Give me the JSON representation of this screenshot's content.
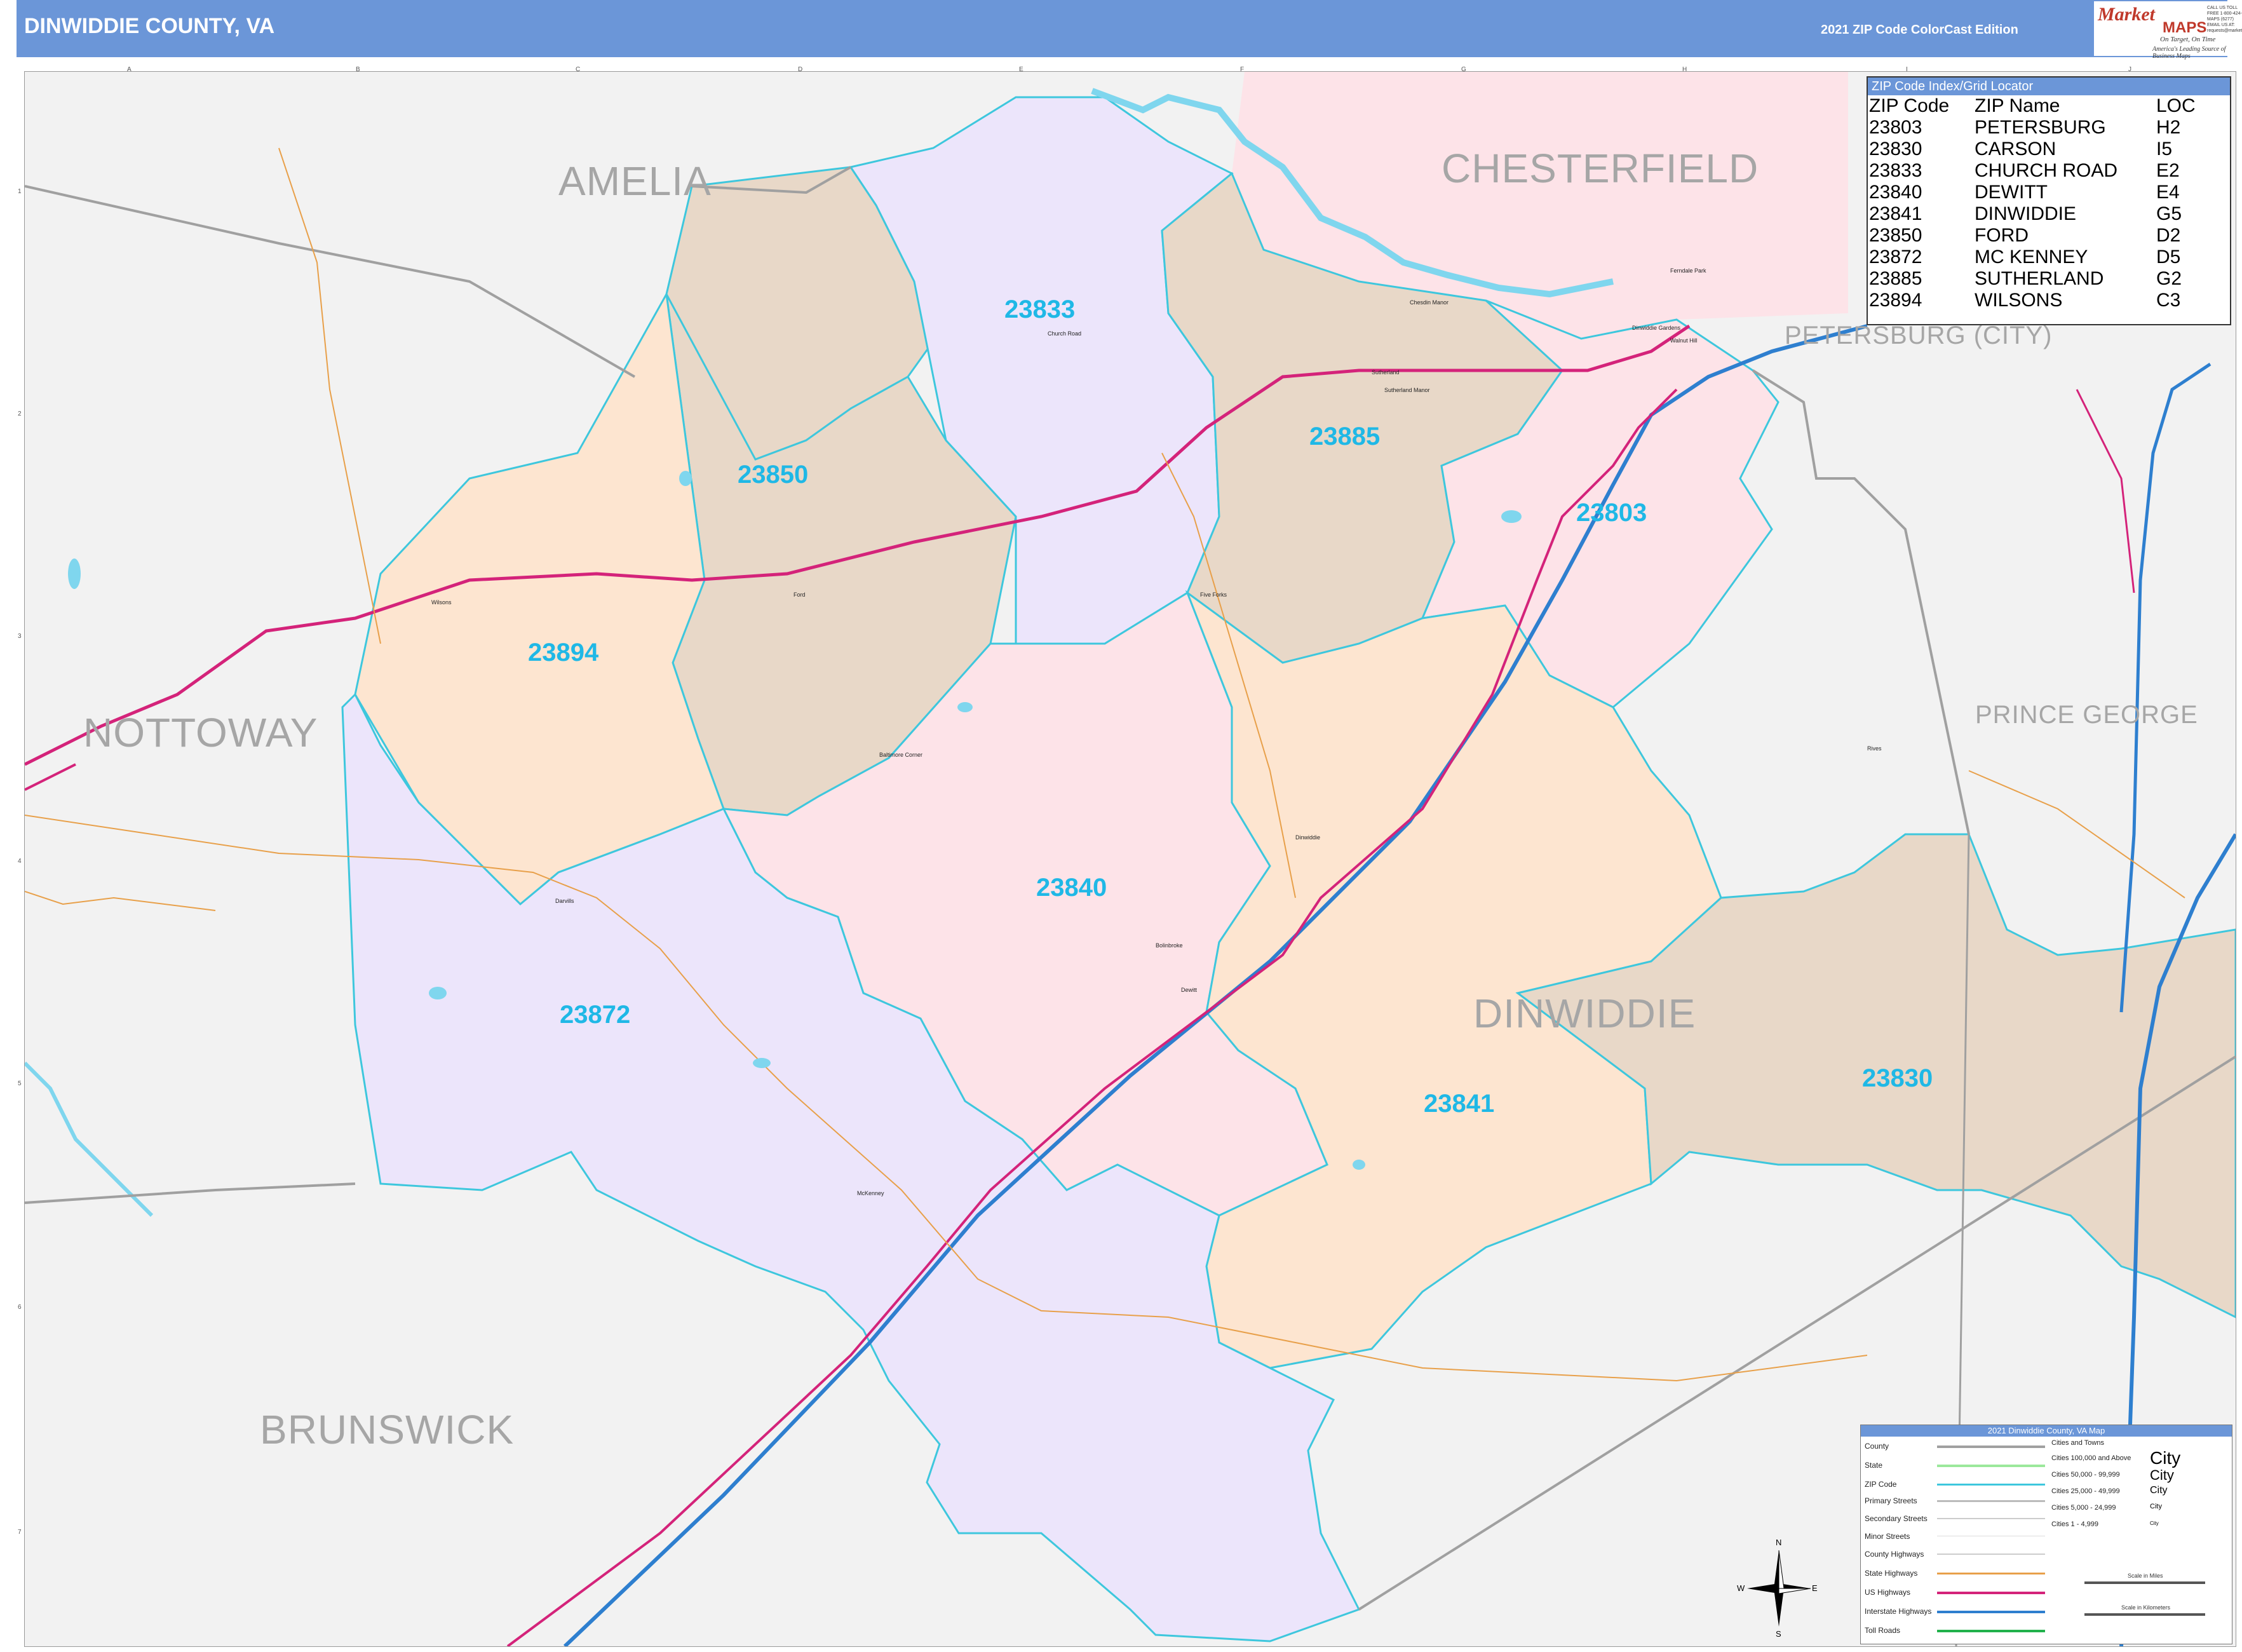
{
  "header": {
    "title": "DINWIDDIE COUNTY, VA",
    "edition": "2021 ZIP Code ColorCast Edition"
  },
  "logo": {
    "brand_top": "Market",
    "brand_bottom": "MAPS",
    "tagline1": "On Target, On Time",
    "tagline2": "America's Leading Source of Business Maps",
    "contact": "CALL US TOLL FREE 1-800-424-MAPS (6277) EMAIL US AT: requests@marketmaps.com"
  },
  "colors": {
    "header_blue": "#6b96d8",
    "zip_label": "#1fb8e6",
    "zip_boundary": "#3ec7dd",
    "county_boundary": "#a0a0a0",
    "interstate": "#2e7fcf",
    "us_highway": "#d4237a",
    "state_highway": "#e8a04a",
    "purple_fill": "#ece5fb",
    "pink_fill": "#fde3e8",
    "peach_fill": "#fde5d0",
    "tan_fill": "#e8d8c8",
    "outside_fill": "#f2f2f2"
  },
  "grid": {
    "columns": [
      "A",
      "B",
      "C",
      "D",
      "E",
      "F",
      "G",
      "H",
      "I",
      "J"
    ],
    "rows": [
      "1",
      "2",
      "3",
      "4",
      "5",
      "6",
      "7"
    ]
  },
  "index": {
    "heading": "ZIP Code Index/Grid Locator",
    "columns": [
      "ZIP Code",
      "ZIP Name",
      "LOC"
    ],
    "rows": [
      [
        "23803",
        "PETERSBURG",
        "H2"
      ],
      [
        "23830",
        "CARSON",
        "I5"
      ],
      [
        "23833",
        "CHURCH ROAD",
        "E2"
      ],
      [
        "23840",
        "DEWITT",
        "E4"
      ],
      [
        "23841",
        "DINWIDDIE",
        "G5"
      ],
      [
        "23850",
        "FORD",
        "D2"
      ],
      [
        "23872",
        "MC KENNEY",
        "D5"
      ],
      [
        "23885",
        "SUTHERLAND",
        "G2"
      ],
      [
        "23894",
        "WILSONS",
        "C3"
      ]
    ]
  },
  "counties": {
    "amelia": "AMELIA",
    "chesterfield": "CHESTERFIELD",
    "petersburg": "PETERSBURG (CITY)",
    "nottoway": "NOTTOWAY",
    "prince_george": "PRINCE GEORGE",
    "dinwiddie": "DINWIDDIE",
    "brunswick": "BRUNSWICK"
  },
  "zips": {
    "z23833": "23833",
    "z23850": "23850",
    "z23885": "23885",
    "z23803": "23803",
    "z23894": "23894",
    "z23840": "23840",
    "z23872": "23872",
    "z23841": "23841",
    "z23830": "23830"
  },
  "towns": {
    "church_road": "Church Road",
    "chesdin": "Chesdin Manor",
    "sutherland": "Sutherland",
    "sutherland_manor": "Sutherland Manor",
    "wilsons": "Wilsons",
    "ford": "Ford",
    "five_forks": "Five Forks",
    "darvills": "Darvills",
    "dinwiddie": "Dinwiddie",
    "dewitt": "Dewitt",
    "baltimore_corner": "Baltimore Corner",
    "mckenney": "McKenney",
    "dinwiddie_gardens": "Dinwiddie Gardens",
    "walnut_hill": "Walnut Hill",
    "rives": "Rives",
    "ferndale": "Ferndale Park",
    "bolinbroke": "Bolinbroke"
  },
  "legend": {
    "heading": "2021 Dinwiddie County, VA Map",
    "items": [
      "County",
      "State",
      "ZIP Code",
      "Primary Streets",
      "Secondary Streets",
      "Minor Streets",
      "County Highways",
      "State Highways",
      "US Highways",
      "Interstate Highways",
      "Toll Roads"
    ],
    "cities_heading": "Cities and Towns",
    "city_sizes": [
      "Cities 100,000 and Above",
      "Cities 50,000 - 99,999",
      "Cities 25,000 - 49,999",
      "Cities 5,000 - 24,999",
      "Cities 1 - 4,999"
    ],
    "city_marks": [
      "City",
      "City",
      "City",
      "City",
      "City"
    ],
    "scale_miles": "Scale in Miles",
    "scale_km": "Scale in Kilometers"
  },
  "compass": {
    "n": "N",
    "s": "S",
    "e": "E",
    "w": "W"
  }
}
